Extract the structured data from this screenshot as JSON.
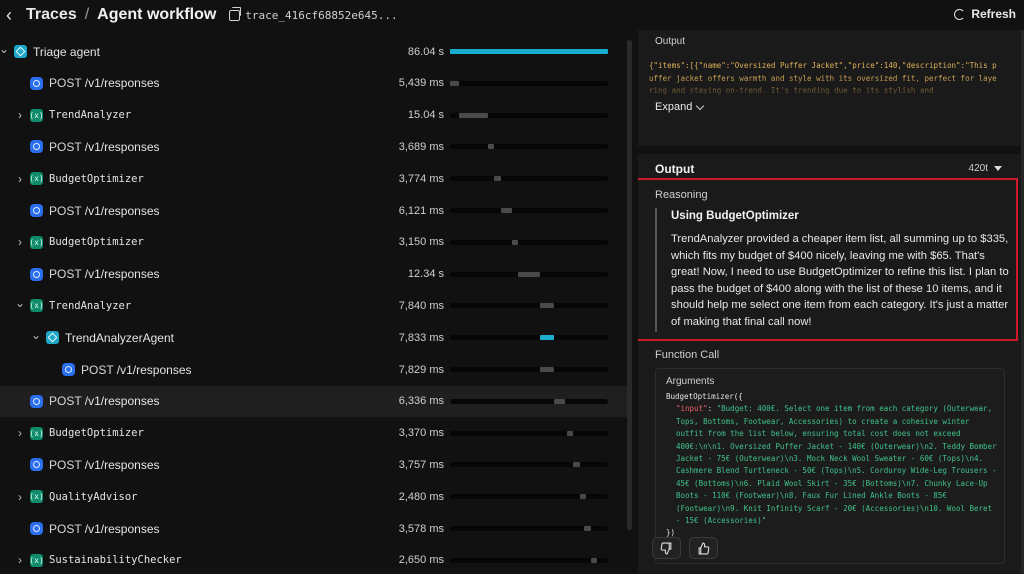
{
  "header": {
    "back_icon": "chevron-left-icon",
    "root_label": "Traces",
    "separator": "/",
    "title": "Agent workflow",
    "trace_id": "trace_416cf68852e645...",
    "refresh_label": "Refresh"
  },
  "spans": [
    {
      "name": "Triage agent",
      "type": "agent",
      "duration": "86.04 s",
      "expand": "open",
      "indent": 0,
      "bar_start": 0.0,
      "bar_len": 1.0
    },
    {
      "name": "/v1/responses",
      "prefix": "POST",
      "type": "request",
      "duration": "5,439 ms",
      "indent": 1,
      "bar_start": 0.0,
      "bar_len": 0.06
    },
    {
      "name": "TrendAnalyzer",
      "type": "function",
      "duration": "15.04 s",
      "expand": "closed",
      "indent": 1,
      "bar_start": 0.06,
      "bar_len": 0.18
    },
    {
      "name": "/v1/responses",
      "prefix": "POST",
      "type": "request",
      "duration": "3,689 ms",
      "indent": 1,
      "bar_start": 0.24,
      "bar_len": 0.04
    },
    {
      "name": "BudgetOptimizer",
      "type": "function",
      "duration": "3,774 ms",
      "expand": "closed",
      "indent": 1,
      "bar_start": 0.28,
      "bar_len": 0.04
    },
    {
      "name": "/v1/responses",
      "prefix": "POST",
      "type": "request",
      "duration": "6,121 ms",
      "indent": 1,
      "bar_start": 0.32,
      "bar_len": 0.07
    },
    {
      "name": "BudgetOptimizer",
      "type": "function",
      "duration": "3,150 ms",
      "expand": "closed",
      "indent": 1,
      "bar_start": 0.39,
      "bar_len": 0.04
    },
    {
      "name": "/v1/responses",
      "prefix": "POST",
      "type": "request",
      "duration": "12.34 s",
      "indent": 1,
      "bar_start": 0.43,
      "bar_len": 0.14
    },
    {
      "name": "TrendAnalyzer",
      "type": "function",
      "duration": "7,840 ms",
      "expand": "open",
      "indent": 1,
      "bar_start": 0.57,
      "bar_len": 0.09
    },
    {
      "name": "TrendAnalyzerAgent",
      "type": "agent",
      "duration": "7,833 ms",
      "expand": "open",
      "indent": 2,
      "bar_start": 0.57,
      "bar_len": 0.09
    },
    {
      "name": "/v1/responses",
      "prefix": "POST",
      "type": "request",
      "duration": "7,829 ms",
      "indent": 3,
      "bar_start": 0.57,
      "bar_len": 0.09
    },
    {
      "name": "/v1/responses",
      "prefix": "POST",
      "type": "request",
      "duration": "6,336 ms",
      "indent": 1,
      "selected": true,
      "bar_start": 0.66,
      "bar_len": 0.07
    },
    {
      "name": "BudgetOptimizer",
      "type": "function",
      "duration": "3,370 ms",
      "expand": "closed",
      "indent": 1,
      "bar_start": 0.74,
      "bar_len": 0.04
    },
    {
      "name": "/v1/responses",
      "prefix": "POST",
      "type": "request",
      "duration": "3,757 ms",
      "indent": 1,
      "bar_start": 0.78,
      "bar_len": 0.04
    },
    {
      "name": "QualityAdvisor",
      "type": "function",
      "duration": "2,480 ms",
      "expand": "closed",
      "indent": 1,
      "bar_start": 0.82,
      "bar_len": 0.03
    },
    {
      "name": "/v1/responses",
      "prefix": "POST",
      "type": "request",
      "duration": "3,578 ms",
      "indent": 1,
      "bar_start": 0.85,
      "bar_len": 0.04
    },
    {
      "name": "SustainabilityChecker",
      "type": "function",
      "duration": "2,650 ms",
      "expand": "closed",
      "indent": 1,
      "bar_start": 0.89,
      "bar_len": 0.03
    }
  ],
  "detail": {
    "input_output_label": "Output",
    "input_output_code": "{\"items\":[{\"name\":\"Oversized Puffer Jacket\",\"price\":140,\"description\":\"This puffer jacket offers warmth and style with its oversized fit, perfect for layering and staying on-trend. It's trending due to its stylish and",
    "expand_label": "Expand",
    "output_label": "Output",
    "output_tokens": "420t",
    "reasoning_label": "Reasoning",
    "reasoning_title": "Using BudgetOptimizer",
    "reasoning_text": "TrendAnalyzer provided a cheaper item list, all summing up to $335, which fits my budget of $400 nicely, leaving me with $65. That's great! Now, I need to use BudgetOptimizer to refine this list. I plan to pass the budget of $400 along with the list of these 10 items, and it should help me select one item from each category. It's just a matter of making that final call now!",
    "function_call_label": "Function Call",
    "arguments_label": "Arguments",
    "call_open": "BudgetOptimizer({",
    "arg_key": "\"input\"",
    "arg_value": "\"Budget: 400€. Select one item from each category (Outerwear, Tops, Bottoms, Footwear, Accessories) to create a cohesive winter outfit from the list below, ensuring total cost does not exceed 400€:\\n\\n1. Oversized Puffer Jacket - 140€ (Outerwear)\\n2. Teddy Bomber Jacket - 75€ (Outerwear)\\n3. Mock Neck Wool Sweater - 60€ (Tops)\\n4. Cashmere Blend Turtleneck - 50€ (Tops)\\n5. Corduroy Wide-Leg Trousers - 45€ (Bottoms)\\n6. Plaid Wool Skirt - 35€ (Bottoms)\\n7. Chunky Lace-Up Boots - 110€ (Footwear)\\n8. Faux Fur Lined Ankle Boots - 85€ (Footwear)\\n9. Knit Infinity Scarf - 20€ (Accessories)\\n10. Wool Beret - 15€ (Accessories)\"",
    "call_close": "})",
    "thumbs_down_icon": "thumbs-down-icon",
    "thumbs_up_icon": "thumbs-up-icon"
  },
  "colors": {
    "accent": "#19aed0",
    "request_icon": "#2a6ff0",
    "function_icon": "#0f8a6a",
    "highlight_border": "#d0182a",
    "string_green": "#3fc28a"
  }
}
